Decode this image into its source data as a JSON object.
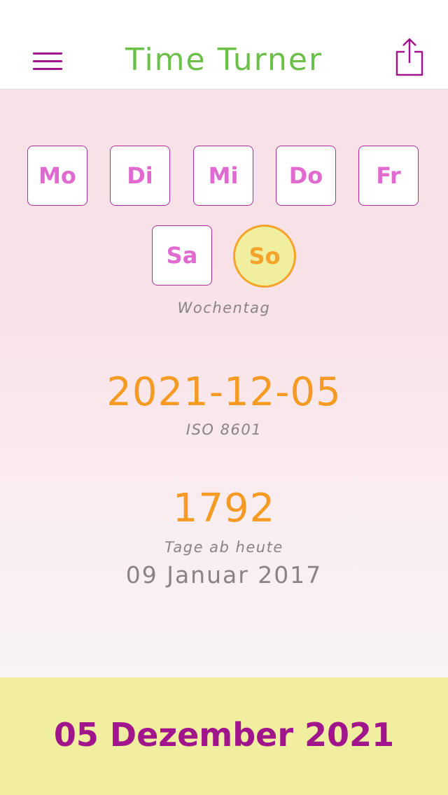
{
  "header": {
    "title": "Time Turner",
    "menu_icon": "hamburger-menu-icon",
    "share_icon": "share-icon"
  },
  "weekdays": {
    "items": [
      {
        "label": "Mo",
        "selected": false
      },
      {
        "label": "Di",
        "selected": false
      },
      {
        "label": "Mi",
        "selected": false
      },
      {
        "label": "Do",
        "selected": false
      },
      {
        "label": "Fr",
        "selected": false
      },
      {
        "label": "Sa",
        "selected": false
      },
      {
        "label": "So",
        "selected": true
      }
    ],
    "caption": "Wochentag"
  },
  "iso": {
    "value": "2021-12-05",
    "caption": "ISO 8601"
  },
  "days_from_today": {
    "value": "1792",
    "caption": "Tage ab heute",
    "reference_date": "09 Januar 2017"
  },
  "footer": {
    "date": "05 Dezember 2021"
  },
  "colors": {
    "accent_purple": "#a0148c",
    "title_green": "#6cc04a",
    "value_orange": "#f59a22",
    "day_pink": "#e06ad0",
    "selected_fill": "#f0ee9f",
    "footer_bg": "#f0ee9f"
  }
}
